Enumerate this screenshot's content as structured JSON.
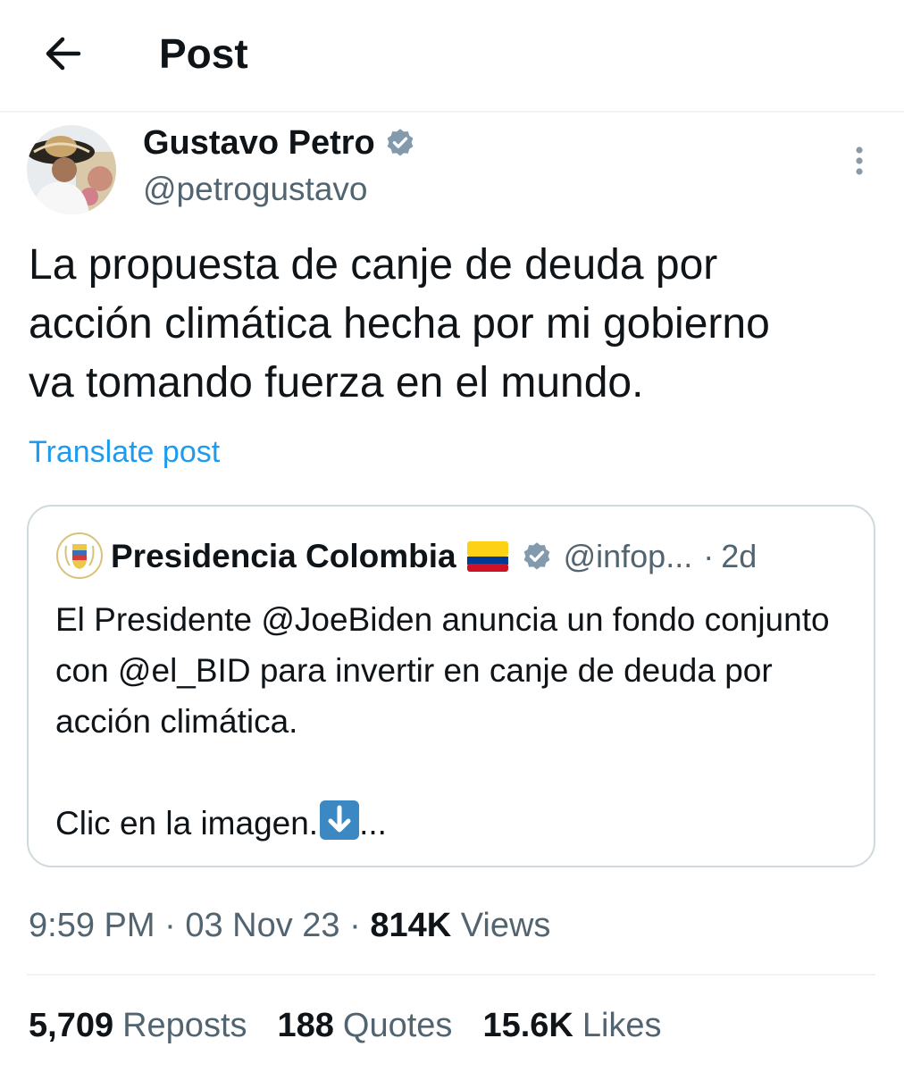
{
  "header": {
    "title": "Post"
  },
  "author": {
    "name": "Gustavo Petro",
    "handle": "@petrogustavo"
  },
  "tweet": {
    "text": "La propuesta de canje de deuda por\nacción climática hecha por mi gobierno\nva tomando fuerza  en el mundo.",
    "translate_label": "Translate post"
  },
  "quote": {
    "name": "Presidencia Colombia",
    "handle": "@infop...",
    "separator": "·",
    "time": "2d",
    "text_line1": "El Presidente @JoeBiden anuncia un fondo conjunto con @el_BID para invertir en canje de deuda por acción climática.",
    "text_line2": "Clic en la imagen.",
    "ellipsis": "..."
  },
  "meta": {
    "time": "9:59 PM",
    "sep1": " · ",
    "date": "03 Nov 23",
    "sep2": " · ",
    "views_count": "814K",
    "views_label": "Views"
  },
  "stats": {
    "reposts_count": "5,709",
    "reposts_label": "Reposts",
    "quotes_count": "188",
    "quotes_label": "Quotes",
    "likes_count": "15.6K",
    "likes_label": "Likes"
  },
  "colors": {
    "link": "#1d9bf0",
    "secondary_text": "#536471",
    "primary_text": "#0f1419",
    "verified_badge": "#829aab",
    "border": "#cfd9de"
  },
  "icons": {
    "back": "arrow-left-icon",
    "verified": "verified-badge-icon",
    "more": "more-vertical-icon",
    "flag": "colombia-flag-icon",
    "down_arrow_emoji": "down-arrow-emoji-icon"
  }
}
